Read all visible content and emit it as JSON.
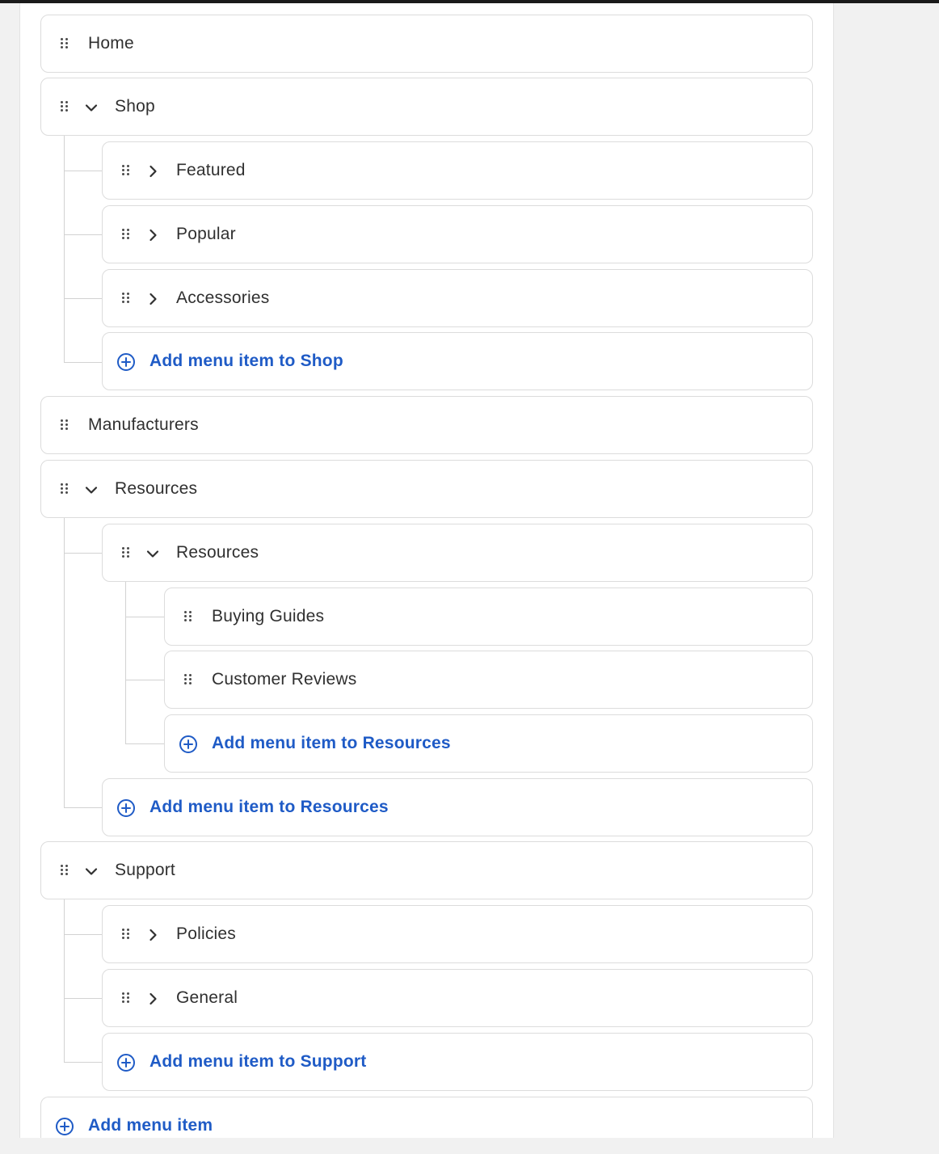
{
  "menu": {
    "items": [
      {
        "label": "Home"
      },
      {
        "label": "Shop",
        "children": [
          {
            "label": "Featured"
          },
          {
            "label": "Popular"
          },
          {
            "label": "Accessories"
          }
        ],
        "add_label": "Add menu item to Shop"
      },
      {
        "label": "Manufacturers"
      },
      {
        "label": "Resources",
        "children": [
          {
            "label": "Resources",
            "children": [
              {
                "label": "Buying Guides"
              },
              {
                "label": "Customer Reviews"
              }
            ],
            "add_label": "Add menu item to Resources"
          }
        ],
        "add_label": "Add menu item to Resources"
      },
      {
        "label": "Support",
        "children": [
          {
            "label": "Policies"
          },
          {
            "label": "General"
          }
        ],
        "add_label": "Add menu item to Support"
      }
    ],
    "add_label": "Add menu item"
  },
  "colors": {
    "accent": "#1f5bc6",
    "text": "#303030",
    "border": "#dcdcdc",
    "background": "#f1f1f1"
  },
  "icons": {
    "drag": "drag-handle-icon",
    "expanded": "chevron-down-icon",
    "collapsed": "chevron-right-icon",
    "add": "plus-circle-icon"
  }
}
